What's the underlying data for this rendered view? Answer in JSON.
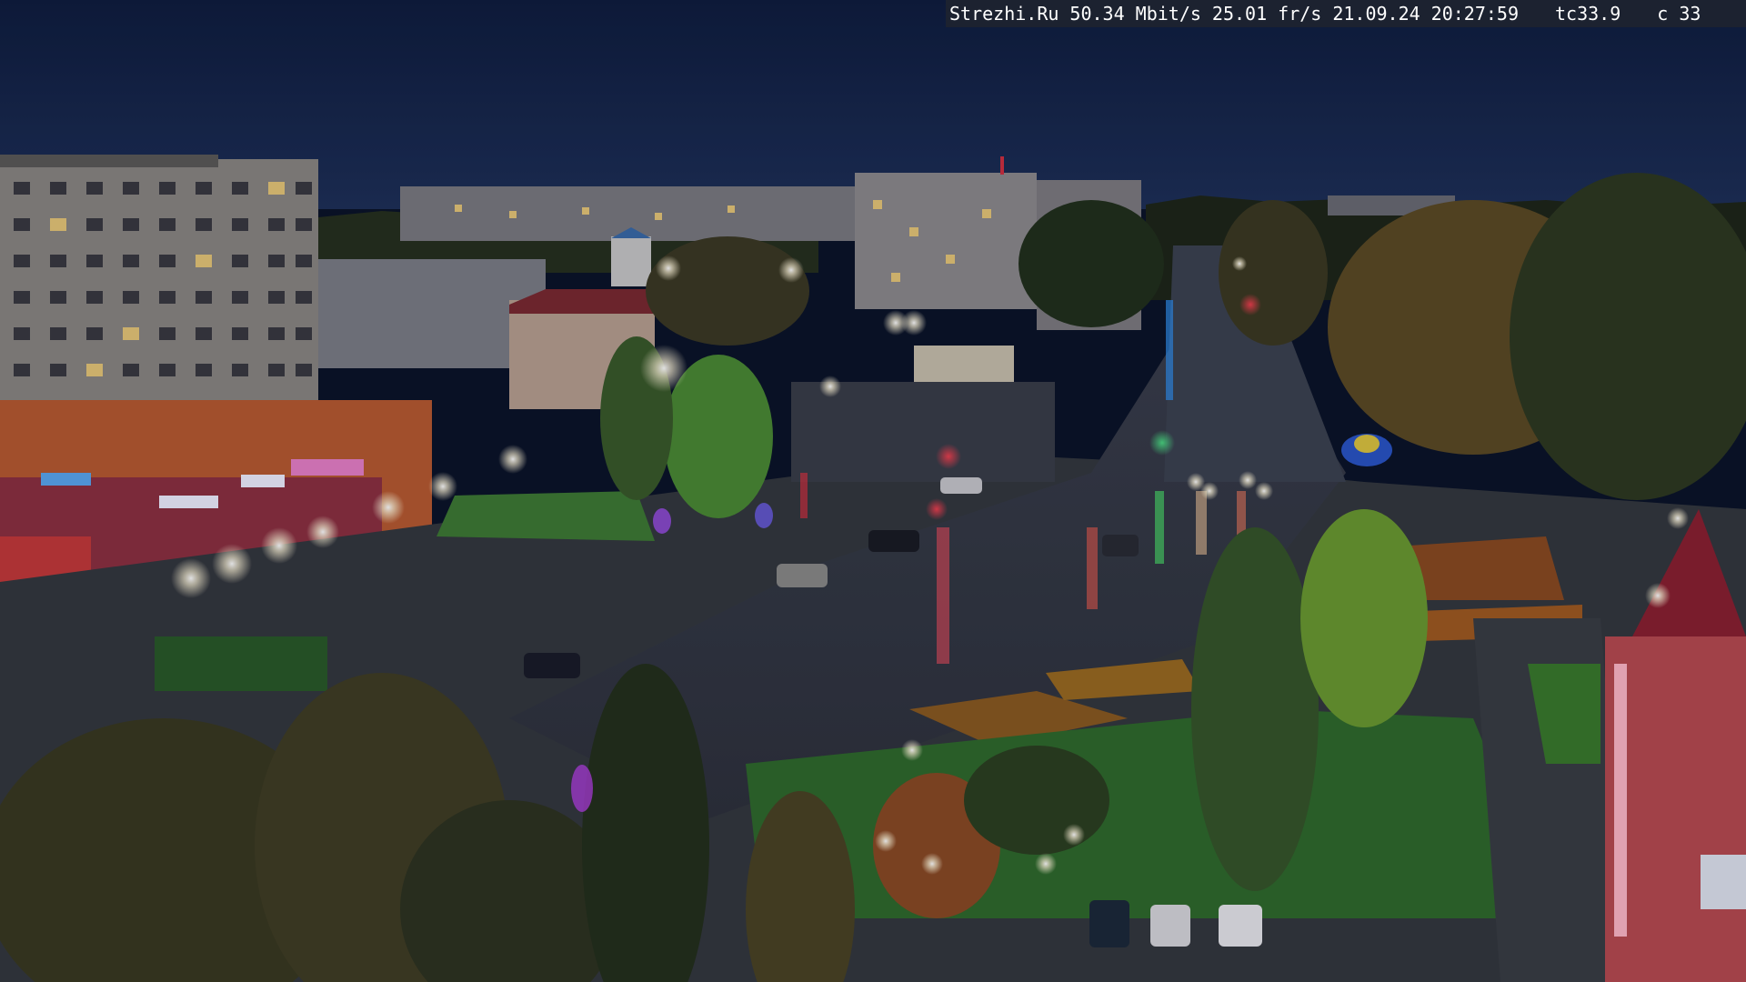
{
  "osd": {
    "site": "Strezhi.Ru",
    "bitrate": "50.34 Mbit/s",
    "framerate": "25.01 fr/s",
    "date": "21.09.24",
    "time": "20:27:59",
    "tc": "tc33.9",
    "c": "c 33"
  },
  "scene": {
    "description_icon": "webcam-night-street-view",
    "sky_color": "#142446",
    "accent_red": "#e0283c",
    "accent_green": "#3ce070"
  }
}
